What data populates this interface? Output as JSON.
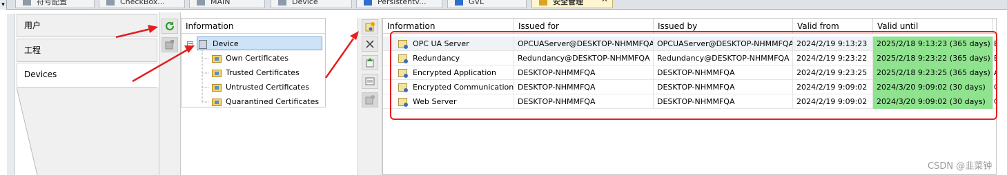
{
  "tabs": [
    {
      "label": "符号配置",
      "icon": "table-icon"
    },
    {
      "label": "CheckBox...",
      "icon": "document-icon"
    },
    {
      "label": "MAIN",
      "icon": "document-icon"
    },
    {
      "label": "Device",
      "icon": "device-icon"
    },
    {
      "label": "Persistentv...",
      "icon": "blue-icon"
    },
    {
      "label": "GVL",
      "icon": "blue-icon"
    },
    {
      "label": "安全管理",
      "icon": "shield-icon",
      "active": true
    }
  ],
  "nav": {
    "items": [
      {
        "label": "用户"
      },
      {
        "label": "工程"
      },
      {
        "label": "Devices",
        "selected": true
      }
    ]
  },
  "tree": {
    "header": "Information",
    "root": "Device",
    "children": [
      {
        "label": "Own Certificates"
      },
      {
        "label": "Trusted Certificates"
      },
      {
        "label": "Untrusted Certificates"
      },
      {
        "label": "Quarantined Certificates"
      }
    ]
  },
  "table": {
    "columns": [
      "Information",
      "Issued for",
      "Issued by",
      "Valid from",
      "Valid until"
    ],
    "rows": [
      {
        "info": "OPC UA Server",
        "issued_for": "OPCUAServer@DESKTOP-NHMMFQA",
        "issued_by": "OPCUAServer@DESKTOP-NHMMFQA",
        "valid_from": "2024/2/19 9:13:23",
        "valid_until": "2025/2/18 9:13:23 (365 days)",
        "extra": "E"
      },
      {
        "info": "Redundancy",
        "issued_for": "Redundancy@DESKTOP-NHMMFQA",
        "issued_by": "Redundancy@DESKTOP-NHMMFQA",
        "valid_from": "2024/2/19 9:23:22",
        "valid_until": "2025/2/18 9:23:22 (365 days)",
        "extra": "E"
      },
      {
        "info": "Encrypted Application",
        "issued_for": "DESKTOP-NHMMFQA",
        "issued_by": "DESKTOP-NHMMFQA",
        "valid_from": "2024/2/19 9:23:25",
        "valid_until": "2025/2/18 9:23:25 (365 days)",
        "extra": "A"
      },
      {
        "info": "Encrypted Communication",
        "issued_for": "DESKTOP-NHMMFQA",
        "issued_by": "DESKTOP-NHMMFQA",
        "valid_from": "2024/2/19 9:09:02",
        "valid_until": "2024/3/20 9:09:02 (30 days)",
        "extra": "C"
      },
      {
        "info": "Web Server",
        "issued_for": "DESKTOP-NHMMFQA",
        "issued_by": "DESKTOP-NHMMFQA",
        "valid_from": "2024/2/19 9:09:02",
        "valid_until": "2024/3/20 9:09:02 (30 days)",
        "extra": "C"
      }
    ]
  },
  "colors": {
    "valid_highlight": "#8fe38f",
    "annotation": "#e41e1e",
    "selection": "#cfe3f7"
  },
  "watermark": "CSDN @韭菜钟"
}
